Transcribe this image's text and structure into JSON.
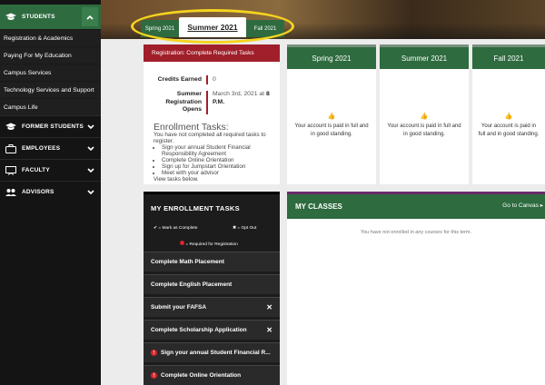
{
  "sidebar": {
    "students_label": "STUDENTS",
    "student_items": [
      "Registration & Academics",
      "Paying For My Education",
      "Campus Services",
      "Technology Services and Support",
      "Campus Life"
    ],
    "former_students_label": "FORMER STUDENTS",
    "employees_label": "EMPLOYEES",
    "faculty_label": "FACULTY",
    "advisors_label": "ADVISORS"
  },
  "tabs": {
    "left": "Spring 2021",
    "active": "Summer 2021",
    "right": "Fall 2021"
  },
  "registration": {
    "header": "Registration: Complete Required Tasks",
    "credits_key": "Credits Earned",
    "credits_value": "0",
    "opens_key_line1": "Summer",
    "opens_key_line2": "Registration",
    "opens_key_line3": "Opens",
    "opens_value_line1": "March 3rd, 2021 at",
    "opens_value_bold1": "8",
    "opens_value_bold2": "P.M.",
    "tasks_title": "Enrollment Tasks:",
    "tasks_intro": "You have not completed all required tasks to register.",
    "task_list": [
      "Sign your annual Student Financial Responsibility Agreement",
      "Complete Online Orientation",
      "Sign up for Jumpstart Orientation",
      "Meet with your advisor"
    ],
    "tasks_footer": "View tasks below."
  },
  "semesters": [
    {
      "name": "Spring 2021",
      "status": "Your account is paid in full and in good standing."
    },
    {
      "name": "Summer 2021",
      "status": "Your account is paid in full and in good standing."
    },
    {
      "name": "Fall 2021",
      "status": "Your account is paid in full and in good standing."
    }
  ],
  "enrollment": {
    "title": "MY ENROLLMENT TASKS",
    "legend_complete": "= Mark as Complete",
    "legend_optout": "= Opt Out",
    "legend_required": "= Required for Registration",
    "items": [
      {
        "label": "Complete Math Placement",
        "x": false,
        "req": false
      },
      {
        "label": "Complete English Placement",
        "x": false,
        "req": false
      },
      {
        "label": "Submit your FAFSA",
        "x": true,
        "req": false
      },
      {
        "label": "Complete Scholarship Application",
        "x": true,
        "req": false
      },
      {
        "label": "Sign your annual Student Financial R...",
        "x": false,
        "req": true
      },
      {
        "label": "Complete Online Orientation",
        "x": false,
        "req": true
      }
    ]
  },
  "classes": {
    "title": "MY CLASSES",
    "canvas_link": "Go to Canvas",
    "empty_text": "You have not enrolled in any courses for this term."
  },
  "colors": {
    "green": "#2e6b3f",
    "red": "#a01f2a",
    "highlight": "#f5d41e"
  }
}
